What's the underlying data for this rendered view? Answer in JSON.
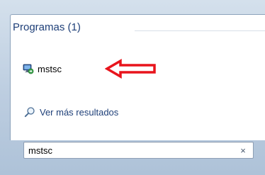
{
  "results": {
    "group_title": "Programas (1)",
    "items": [
      {
        "label": "mstsc",
        "icon": "remote-desktop-icon"
      }
    ],
    "more_results_label": "Ver más resultados",
    "more_results_icon": "magnifier-icon"
  },
  "annotation": {
    "arrow_color": "#e8141c"
  },
  "search": {
    "value": "mstsc",
    "clear_label": "×",
    "clear_icon": "clear-icon"
  },
  "colors": {
    "header_text": "#1e3f78",
    "link_text": "#1e3f78"
  }
}
